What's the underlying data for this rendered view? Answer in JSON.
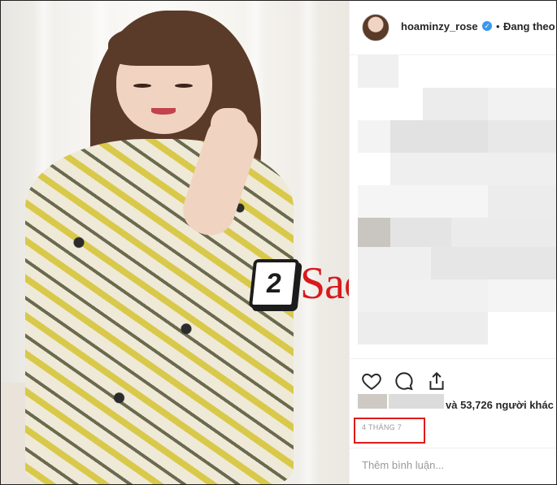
{
  "post": {
    "username": "hoaminzy_rose",
    "verified_badge": "✓",
    "separator": "•",
    "follow_label": "Đang theo",
    "likes_text": "và 53,726 người khác",
    "date": "4 THÁNG 7",
    "comment_placeholder": "Thêm bình luận..."
  },
  "watermark": {
    "number": "2",
    "text": "Sao",
    "color": "#d9191c"
  },
  "icons": [
    "heart-icon",
    "comment-icon",
    "share-icon",
    "verified-icon"
  ],
  "colors": {
    "verified": "#3897f0",
    "highlight_box": "#e01a1a"
  }
}
